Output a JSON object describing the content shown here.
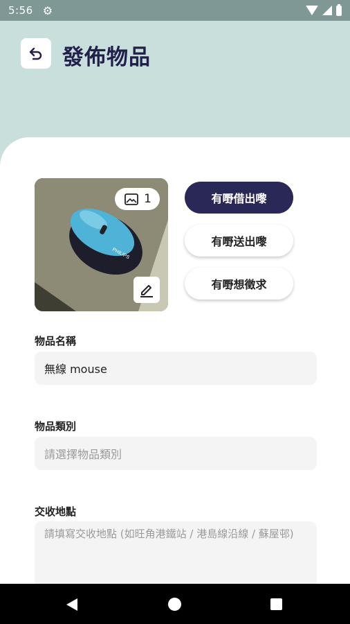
{
  "status_bar": {
    "time": "5:56",
    "icons": [
      "gear-icon",
      "wifi-icon",
      "signal-icon",
      "battery-icon"
    ]
  },
  "header": {
    "title": "發佈物品",
    "back_icon": "undo-arrow-icon"
  },
  "photo": {
    "count": "1",
    "image_icon": "image-icon",
    "edit_icon": "pencil-icon",
    "description_colors": {
      "mouse_body": "#4fb3d8",
      "mouse_base": "#1d1d2b",
      "desk": "#8a8a72"
    }
  },
  "listing_types": [
    {
      "label": "有嘢借出嚟",
      "selected": true
    },
    {
      "label": "有嘢送出嚟",
      "selected": false
    },
    {
      "label": "有嘢想徵求",
      "selected": false
    }
  ],
  "form": {
    "name_label": "物品名稱",
    "name_value": "無線 mouse",
    "category_label": "物品類別",
    "category_placeholder": "請選擇物品類別",
    "location_label": "交收地點",
    "location_placeholder": "請填寫交收地點 (如旺角港鐵站 / 港島線沿線 / 蘇屋邨)"
  },
  "colors": {
    "header_bg": "#c9dfdc",
    "primary": "#2a2856",
    "status_bar": "#7f9896"
  }
}
